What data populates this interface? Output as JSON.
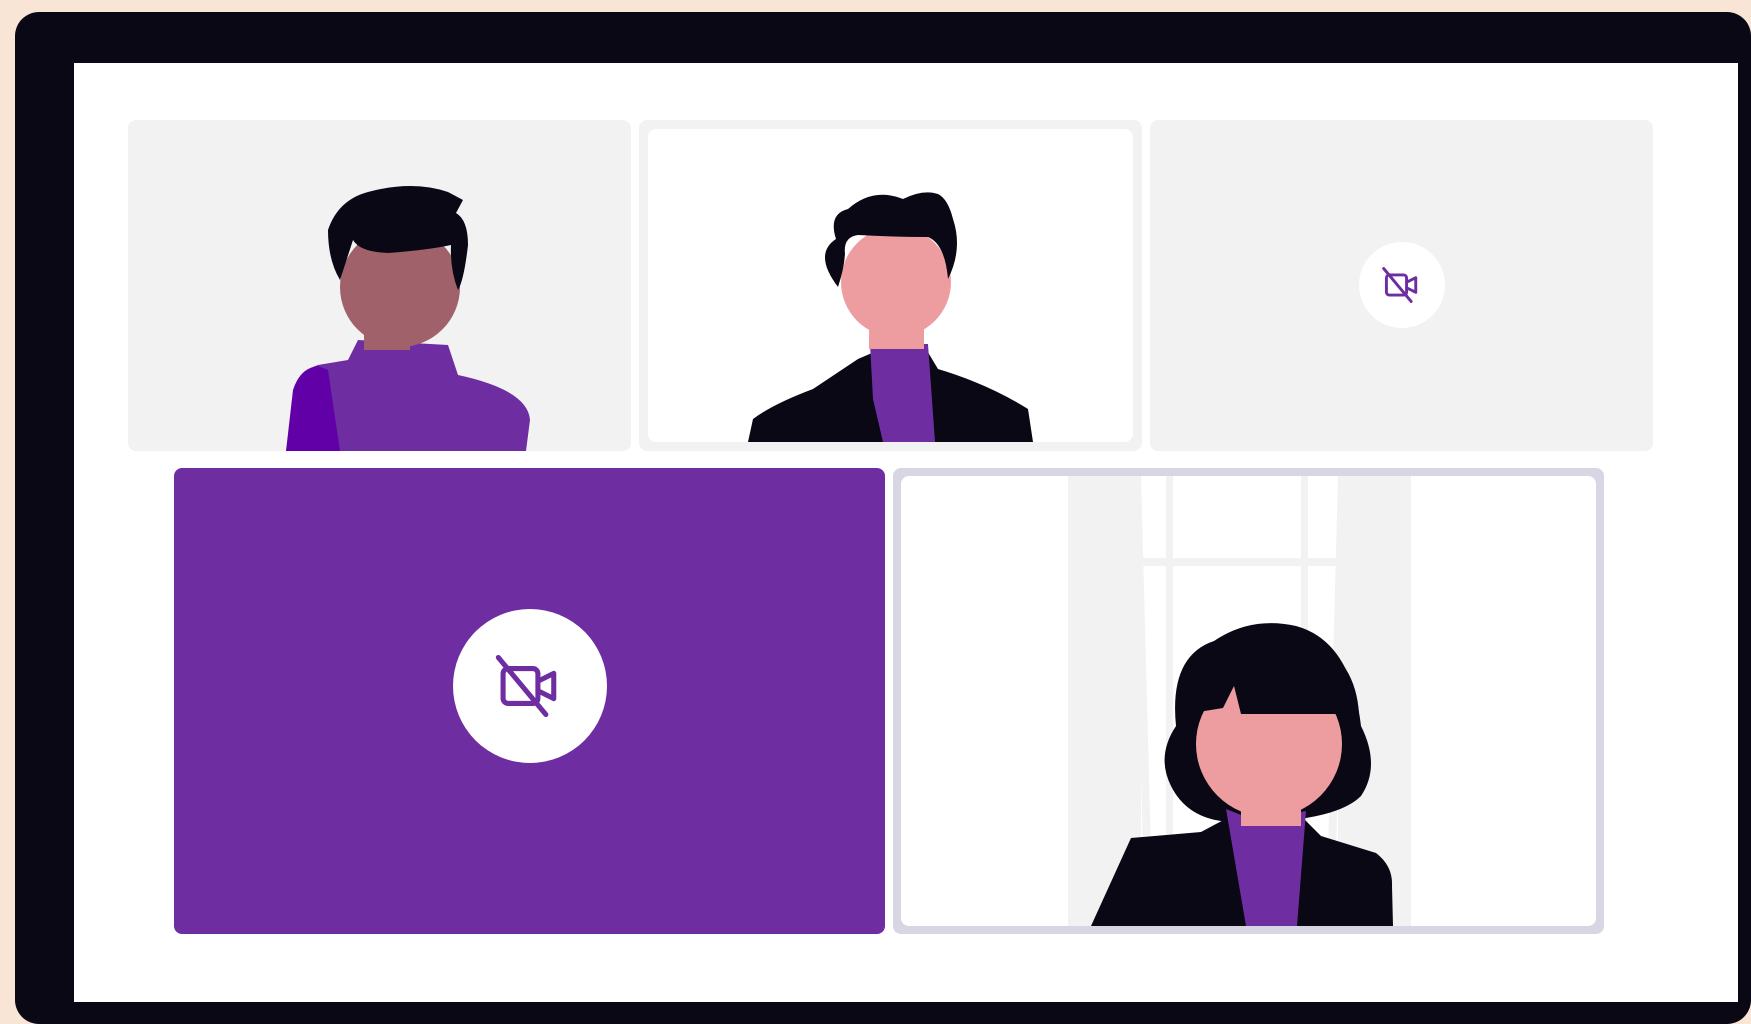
{
  "call": {
    "participants": [
      {
        "id": "p1",
        "camera": "on",
        "avatar": "person-dark-skin-purple-sweater"
      },
      {
        "id": "p2",
        "camera": "on",
        "avatar": "person-black-jacket-purple-shirt"
      },
      {
        "id": "p3",
        "camera": "off",
        "icon": "video-off-icon"
      },
      {
        "id": "p4",
        "camera": "off",
        "icon": "video-off-icon",
        "highlighted": true
      },
      {
        "id": "p5",
        "camera": "on",
        "avatar": "woman-black-hair-window-background"
      }
    ]
  },
  "colors": {
    "background": "#f8e5d6",
    "bezel": "#090814",
    "screen": "#ffffff",
    "tile": "#f2f2f2",
    "accent": "#6f2da2",
    "accent_dark": "#6200a8",
    "active_border": "#d7d6e2",
    "hair": "#090814",
    "skin_dark": "#a0616a",
    "skin_light": "#ed9da0"
  }
}
